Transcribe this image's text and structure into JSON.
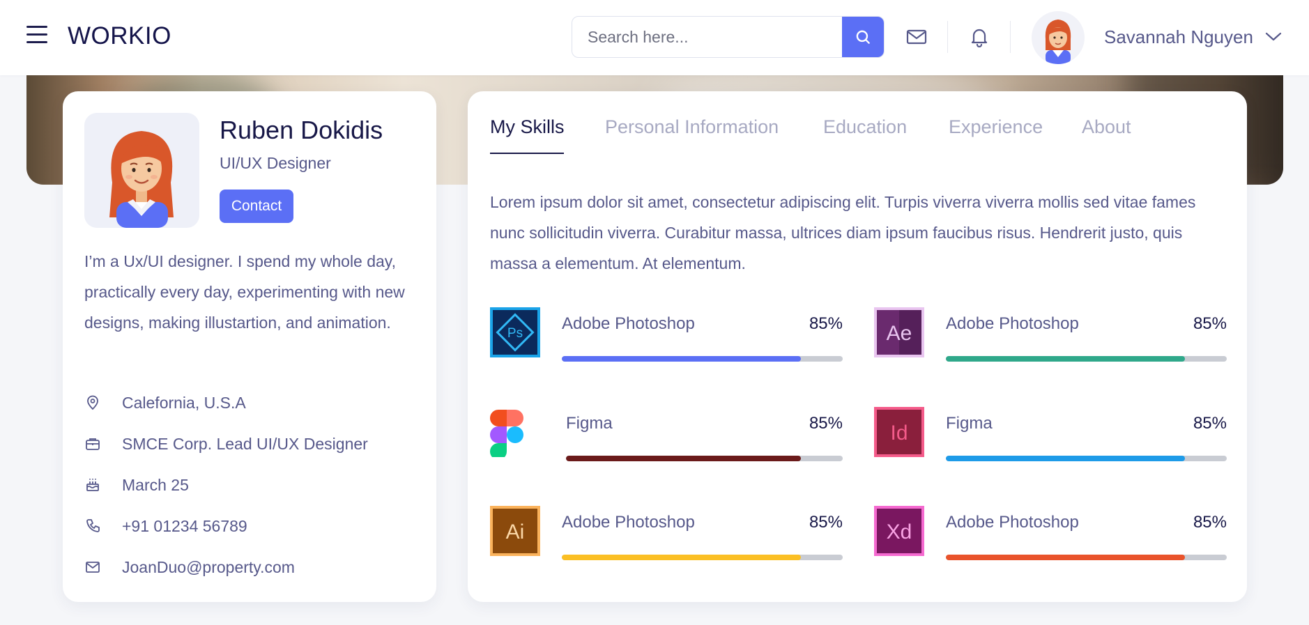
{
  "header": {
    "brand": "WORKIO",
    "search_placeholder": "Search here...",
    "user_name": "Savannah Nguyen"
  },
  "profile": {
    "name": "Ruben Dokidis",
    "role": "UI/UX Designer",
    "contact_label": "Contact",
    "bio": "I’m a Ux/UI designer. I spend my whole day, practically every day, experimenting with new designs, making illustartion, and animation.",
    "info": [
      {
        "icon": "location-pin-icon",
        "text": "Calefornia, U.S.A"
      },
      {
        "icon": "briefcase-icon",
        "text": "SMCE Corp. Lead UI/UX Designer"
      },
      {
        "icon": "birthday-cake-icon",
        "text": "March 25"
      },
      {
        "icon": "phone-icon",
        "text": "+91 01234 56789"
      },
      {
        "icon": "mail-icon",
        "text": "JoanDuo@property.com"
      }
    ]
  },
  "tabs": [
    {
      "label": "My Skills",
      "active": true
    },
    {
      "label": "Personal Information",
      "active": false
    },
    {
      "label": "Education",
      "active": false
    },
    {
      "label": "Experience",
      "active": false
    },
    {
      "label": "About",
      "active": false
    }
  ],
  "skills_description": "Lorem ipsum dolor sit amet, consectetur adipiscing elit. Turpis viverra viverra mollis sed vitae fames nunc sollicitudin viverra. Curabitur massa, ultrices diam ipsum faucibus risus. Hendrerit justo, quis massa a elementum. At elementum.",
  "skills": [
    {
      "name": "Adobe Photoshop",
      "percent_label": "85%",
      "level": 0.85,
      "app_icon": "photoshop-icon",
      "color": "#5b6ff5"
    },
    {
      "name": "Adobe Photoshop",
      "percent_label": "85%",
      "level": 0.85,
      "app_icon": "after-effects-icon",
      "color": "#2fa88a"
    },
    {
      "name": "Figma",
      "percent_label": "85%",
      "level": 0.85,
      "app_icon": "figma-icon",
      "color": "#6b1a1a"
    },
    {
      "name": "Figma",
      "percent_label": "85%",
      "level": 0.85,
      "app_icon": "indesign-icon",
      "color": "#1e9be8"
    },
    {
      "name": "Adobe Photoshop",
      "percent_label": "85%",
      "level": 0.85,
      "app_icon": "illustrator-icon",
      "color": "#fbbf24"
    },
    {
      "name": "Adobe Photoshop",
      "percent_label": "85%",
      "level": 0.85,
      "app_icon": "xd-icon",
      "color": "#e9532b"
    }
  ],
  "app_icon_letters": {
    "photoshop": "Ps",
    "after_effects": "Ae",
    "indesign": "Id",
    "illustrator": "Ai",
    "xd": "Xd"
  }
}
